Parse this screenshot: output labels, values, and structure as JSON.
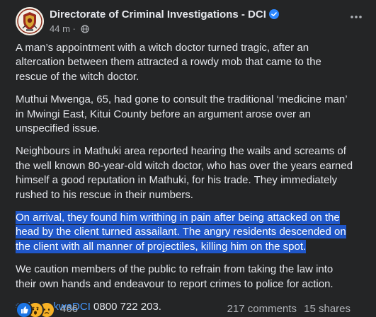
{
  "post": {
    "author": "Directorate of Criminal Investigations - DCI",
    "time": "44 m",
    "separator": "·",
    "paragraphs": [
      "A man’s appointment with a witch doctor  turned tragic, after an altercation between them attracted a rowdy mob that came to the rescue of the witch doctor.",
      "Muthui Mwenga, 65, had gone to consult the traditional ‘medicine man’ in Mwingi East, Kitui County before an argument arose over an unspecified issue.",
      "Neighbours in Mathuki area reported hearing the wails and screams of the well known 80-year-old witch doctor, who has over the years earned himself a good reputation in Mathuki, for his trade. They immediately rushed to his rescue in their numbers."
    ],
    "highlighted_paragraph": "On arrival, they found him writhing in pain after being attacked on the head by the client turned assailant. The angry residents descended on the client with all manner of projectiles, killing him on the spot.",
    "caution_paragraph": "We caution members of the public to refrain from taking the law into their own hands and  endeavour to report crimes to police for action.",
    "hashtag": "#FichuakwaDCI",
    "phone": " 0800 722 203."
  },
  "footer": {
    "reaction_count": "466",
    "comments": "217 comments",
    "shares": "15 shares"
  },
  "icons": {
    "avatar": "dci-logo-avatar",
    "verified": "verified-badge-icon",
    "audience": "globe-icon",
    "more": "more-options-icon",
    "reactions": [
      "like-reaction-icon",
      "wow-reaction-icon",
      "sad-reaction-icon"
    ]
  },
  "colors": {
    "background": "#242526",
    "text": "#e4e6eb",
    "secondary_text": "#b0b3b8",
    "highlight": "#1f56c8",
    "hashtag": "#4599ff",
    "verified": "#2d88ff"
  }
}
